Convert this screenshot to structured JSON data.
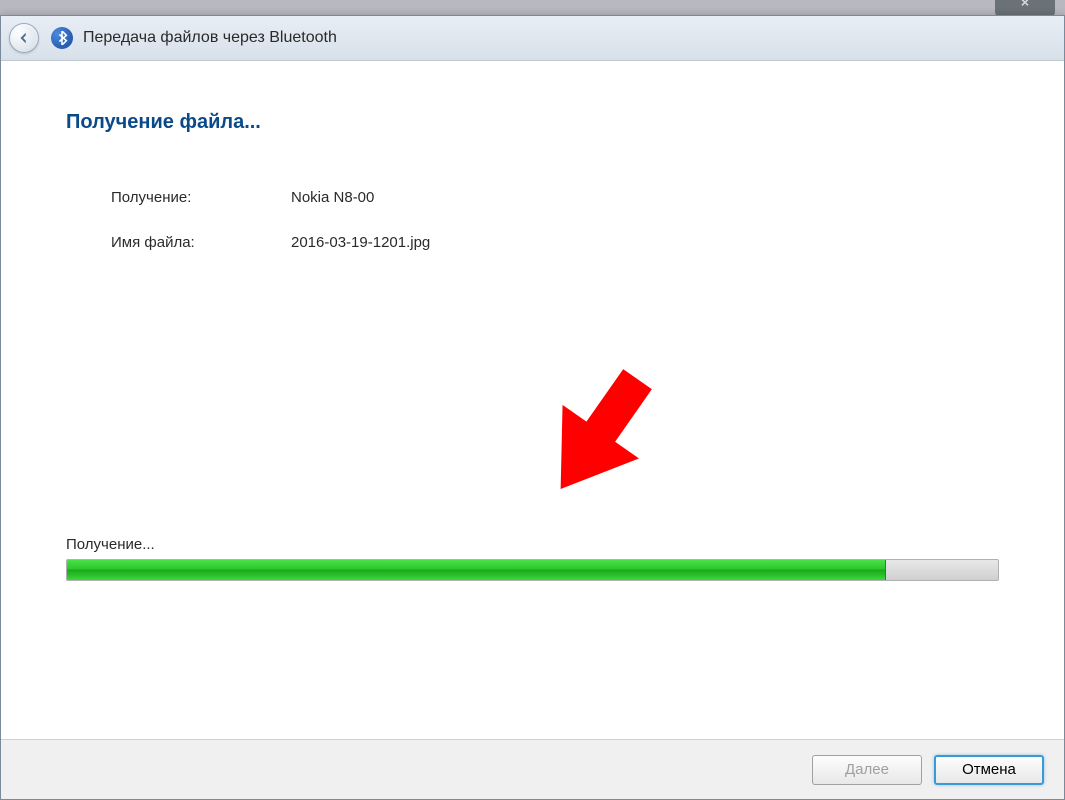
{
  "titlebar": {
    "title": "Передача файлов через Bluetooth"
  },
  "content": {
    "heading": "Получение файла...",
    "rows": [
      {
        "label": "Получение:",
        "value": "Nokia N8-00"
      },
      {
        "label": "Имя файла:",
        "value": "2016-03-19-1201.jpg"
      }
    ],
    "progress": {
      "label": "Получение...",
      "percent": 88
    }
  },
  "buttons": {
    "next": "Далее",
    "cancel": "Отмена"
  },
  "close_glyph": "×"
}
